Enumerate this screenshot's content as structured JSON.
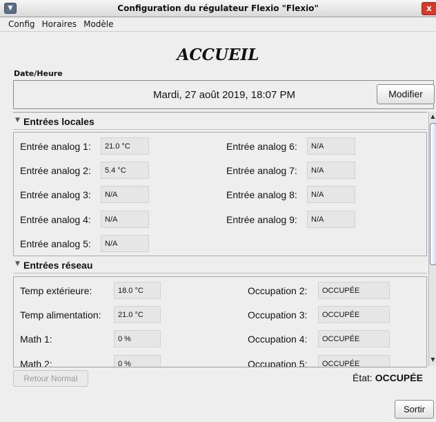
{
  "window": {
    "title": "Configuration du régulateur Flexio \"Flexio\"",
    "close": "x"
  },
  "menu": [
    "Config",
    "Horaires",
    "Modèle"
  ],
  "page_title": "ACCUEIL",
  "datetime": {
    "label": "Date/Heure",
    "value": "Mardi, 27 août 2019, 18:07 PM",
    "button": "Modifier"
  },
  "local_inputs": {
    "header": "Entrées locales",
    "left": [
      {
        "label": "Entrée analog 1:",
        "value": "21.0 °C"
      },
      {
        "label": "Entrée analog 2:",
        "value": "5.4 °C"
      },
      {
        "label": "Entrée analog 3:",
        "value": "N/A"
      },
      {
        "label": "Entrée analog 4:",
        "value": "N/A"
      },
      {
        "label": "Entrée analog 5:",
        "value": "N/A"
      }
    ],
    "right": [
      {
        "label": "Entrée analog 6:",
        "value": "N/A"
      },
      {
        "label": "Entrée analog 7:",
        "value": "N/A"
      },
      {
        "label": "Entrée analog 8:",
        "value": "N/A"
      },
      {
        "label": "Entrée analog 9:",
        "value": "N/A"
      }
    ]
  },
  "network_inputs": {
    "header": "Entrées réseau",
    "left": [
      {
        "label": "Temp extérieure:",
        "value": "18.0 °C"
      },
      {
        "label": "Temp alimentation:",
        "value": "21.0 °C"
      },
      {
        "label": "Math 1:",
        "value": "0 %"
      },
      {
        "label": "Math 2:",
        "value": "0 %"
      }
    ],
    "right": [
      {
        "label": "Occupation 2:",
        "value": "OCCUPÉE"
      },
      {
        "label": "Occupation 3:",
        "value": "OCCUPÉE"
      },
      {
        "label": "Occupation 4:",
        "value": "OCCUPÉE"
      },
      {
        "label": "Occupation 5:",
        "value": "OCCUPÉE"
      }
    ]
  },
  "footer": {
    "retour": "Retour Normal",
    "etat_label": "État:",
    "etat_value": "OCCUPÉE",
    "sortir": "Sortir"
  },
  "icons": {
    "window_menu": "window-menu-icon",
    "close": "close-icon",
    "collapse": "triangle-down-icon",
    "scroll_up": "arrow-up-icon",
    "scroll_down": "arrow-down-icon"
  }
}
